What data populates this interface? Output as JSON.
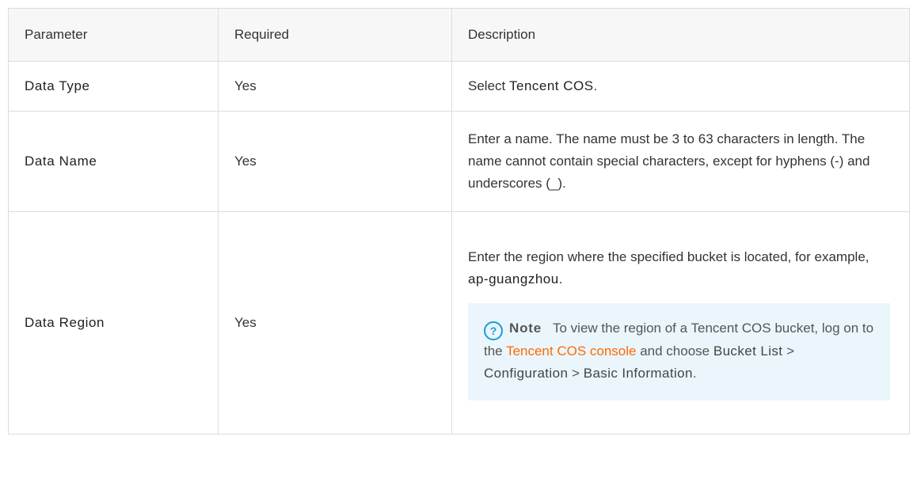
{
  "table": {
    "headers": [
      "Parameter",
      "Required",
      "Description"
    ],
    "rows": [
      {
        "parameter": "Data Type",
        "required": "Yes",
        "description": {
          "prefix": "Select ",
          "strong": "Tencent COS",
          "suffix": "."
        }
      },
      {
        "parameter": "Data Name",
        "required": "Yes",
        "description": {
          "text": "Enter a name. The name must be 3 to 63 characters in length. The name cannot contain special characters, except for hyphens (-) and underscores (_)."
        }
      },
      {
        "parameter": "Data Region",
        "required": "Yes",
        "description": {
          "prefix": "Enter the region where the specified bucket is located, for example, ",
          "strong": "ap-guangzhou",
          "suffix": "."
        },
        "note": {
          "icon": "question-circle-icon",
          "label": "Note",
          "text1": "To view the region of a Tencent COS bucket, log on to the ",
          "link": "Tencent COS console",
          "text2": " and choose ",
          "path1": "Bucket List",
          "sep1": " > ",
          "path2": "Configuration",
          "sep2": " > ",
          "path3": "Basic Information",
          "end": "."
        }
      }
    ]
  },
  "colors": {
    "link": "#ff6a00",
    "note_background": "#eaf6fc",
    "note_icon": "#1a9bd7",
    "border": "#dcdcdc",
    "header_background": "#f7f7f7"
  }
}
